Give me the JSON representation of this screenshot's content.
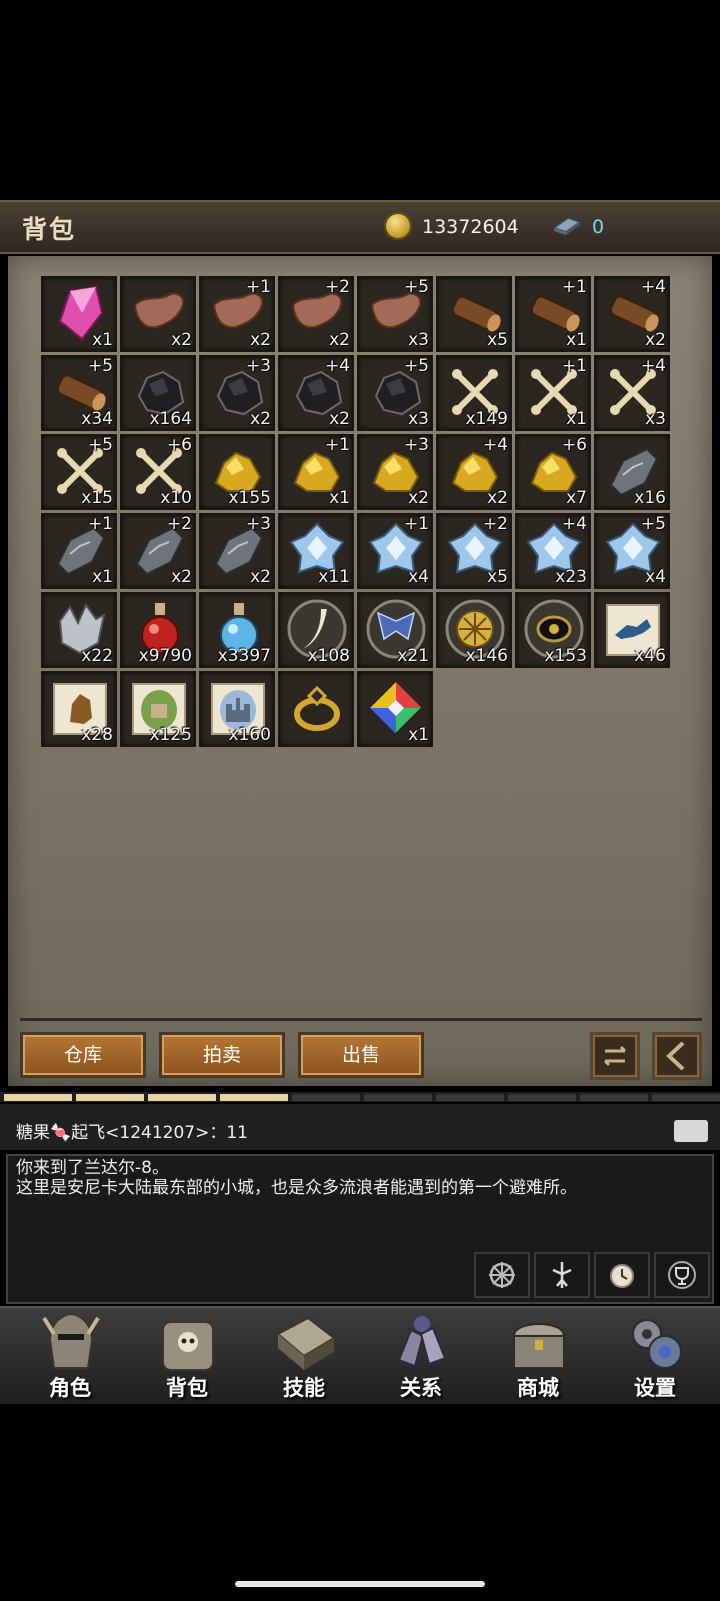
{
  "header": {
    "title": "背包",
    "gold": "13372604",
    "gems": "0"
  },
  "colors": {
    "accent": "#b77734",
    "panel": "#7b7466",
    "gem_text": "#7fd6ef"
  },
  "items": [
    {
      "icon": "pink-crystal-icon",
      "count": "x1",
      "level": ""
    },
    {
      "icon": "leather-icon",
      "count": "x2",
      "level": ""
    },
    {
      "icon": "leather-icon",
      "count": "x2",
      "level": "+1"
    },
    {
      "icon": "leather-icon",
      "count": "x2",
      "level": "+2"
    },
    {
      "icon": "leather-icon",
      "count": "x3",
      "level": "+5"
    },
    {
      "icon": "log-icon",
      "count": "x5",
      "level": ""
    },
    {
      "icon": "log-icon",
      "count": "x1",
      "level": "+1"
    },
    {
      "icon": "log-icon",
      "count": "x2",
      "level": "+4"
    },
    {
      "icon": "log-icon",
      "count": "x34",
      "level": "+5"
    },
    {
      "icon": "coal-ore-icon",
      "count": "x164",
      "level": ""
    },
    {
      "icon": "coal-ore-icon",
      "count": "x2",
      "level": "+3"
    },
    {
      "icon": "coal-ore-icon",
      "count": "x2",
      "level": "+4"
    },
    {
      "icon": "coal-ore-icon",
      "count": "x3",
      "level": "+5"
    },
    {
      "icon": "bone-icon",
      "count": "x149",
      "level": ""
    },
    {
      "icon": "bone-icon",
      "count": "x1",
      "level": "+1"
    },
    {
      "icon": "bone-icon",
      "count": "x3",
      "level": "+4"
    },
    {
      "icon": "bone-icon",
      "count": "x15",
      "level": "+5"
    },
    {
      "icon": "bone-icon",
      "count": "x10",
      "level": "+6"
    },
    {
      "icon": "gold-ore-icon",
      "count": "x155",
      "level": ""
    },
    {
      "icon": "gold-ore-icon",
      "count": "x1",
      "level": "+1"
    },
    {
      "icon": "gold-ore-icon",
      "count": "x2",
      "level": "+3"
    },
    {
      "icon": "gold-ore-icon",
      "count": "x2",
      "level": "+4"
    },
    {
      "icon": "gold-ore-icon",
      "count": "x7",
      "level": "+6"
    },
    {
      "icon": "iron-ore-icon",
      "count": "x16",
      "level": ""
    },
    {
      "icon": "iron-ore-icon",
      "count": "x1",
      "level": "+1"
    },
    {
      "icon": "iron-ore-icon",
      "count": "x2",
      "level": "+2"
    },
    {
      "icon": "iron-ore-icon",
      "count": "x2",
      "level": "+3"
    },
    {
      "icon": "ice-crystal-icon",
      "count": "x11",
      "level": ""
    },
    {
      "icon": "ice-crystal-icon",
      "count": "x4",
      "level": "+1"
    },
    {
      "icon": "ice-crystal-icon",
      "count": "x5",
      "level": "+2"
    },
    {
      "icon": "ice-crystal-icon",
      "count": "x23",
      "level": "+4"
    },
    {
      "icon": "ice-crystal-icon",
      "count": "x4",
      "level": "+5"
    },
    {
      "icon": "silver-crystal-icon",
      "count": "x22",
      "level": ""
    },
    {
      "icon": "red-potion-icon",
      "count": "x9790",
      "level": ""
    },
    {
      "icon": "blue-potion-icon",
      "count": "x3397",
      "level": ""
    },
    {
      "icon": "fang-icon",
      "count": "x108",
      "level": ""
    },
    {
      "icon": "blue-wing-icon",
      "count": "x21",
      "level": ""
    },
    {
      "icon": "golden-seal-icon",
      "count": "x146",
      "level": ""
    },
    {
      "icon": "dark-eye-icon",
      "count": "x153",
      "level": ""
    },
    {
      "icon": "wolf-scroll-icon",
      "count": "x46",
      "level": ""
    },
    {
      "icon": "bear-scroll-icon",
      "count": "x28",
      "level": ""
    },
    {
      "icon": "town-scroll-icon",
      "count": "x125",
      "level": ""
    },
    {
      "icon": "castle-scroll-icon",
      "count": "x160",
      "level": ""
    },
    {
      "icon": "gold-ring-icon",
      "count": "",
      "level": ""
    },
    {
      "icon": "rainbow-gem-icon",
      "count": "x1",
      "level": ""
    }
  ],
  "actions": {
    "warehouse": "仓库",
    "auction": "拍卖",
    "sell": "出售"
  },
  "chat": {
    "line": "糖果🍬起飞<1241207>：11",
    "system": "你来到了兰达尔-8。\n这里是安尼卡大陆最东部的小城，也是众多流浪者能遇到的第一个避难所。"
  },
  "nav": [
    {
      "label": "角色",
      "icon": "helmet-icon"
    },
    {
      "label": "背包",
      "icon": "skull-bag-icon"
    },
    {
      "label": "技能",
      "icon": "spellbook-icon"
    },
    {
      "label": "关系",
      "icon": "gauntlets-icon"
    },
    {
      "label": "商城",
      "icon": "treasure-chest-icon"
    },
    {
      "label": "设置",
      "icon": "gears-icon"
    }
  ]
}
